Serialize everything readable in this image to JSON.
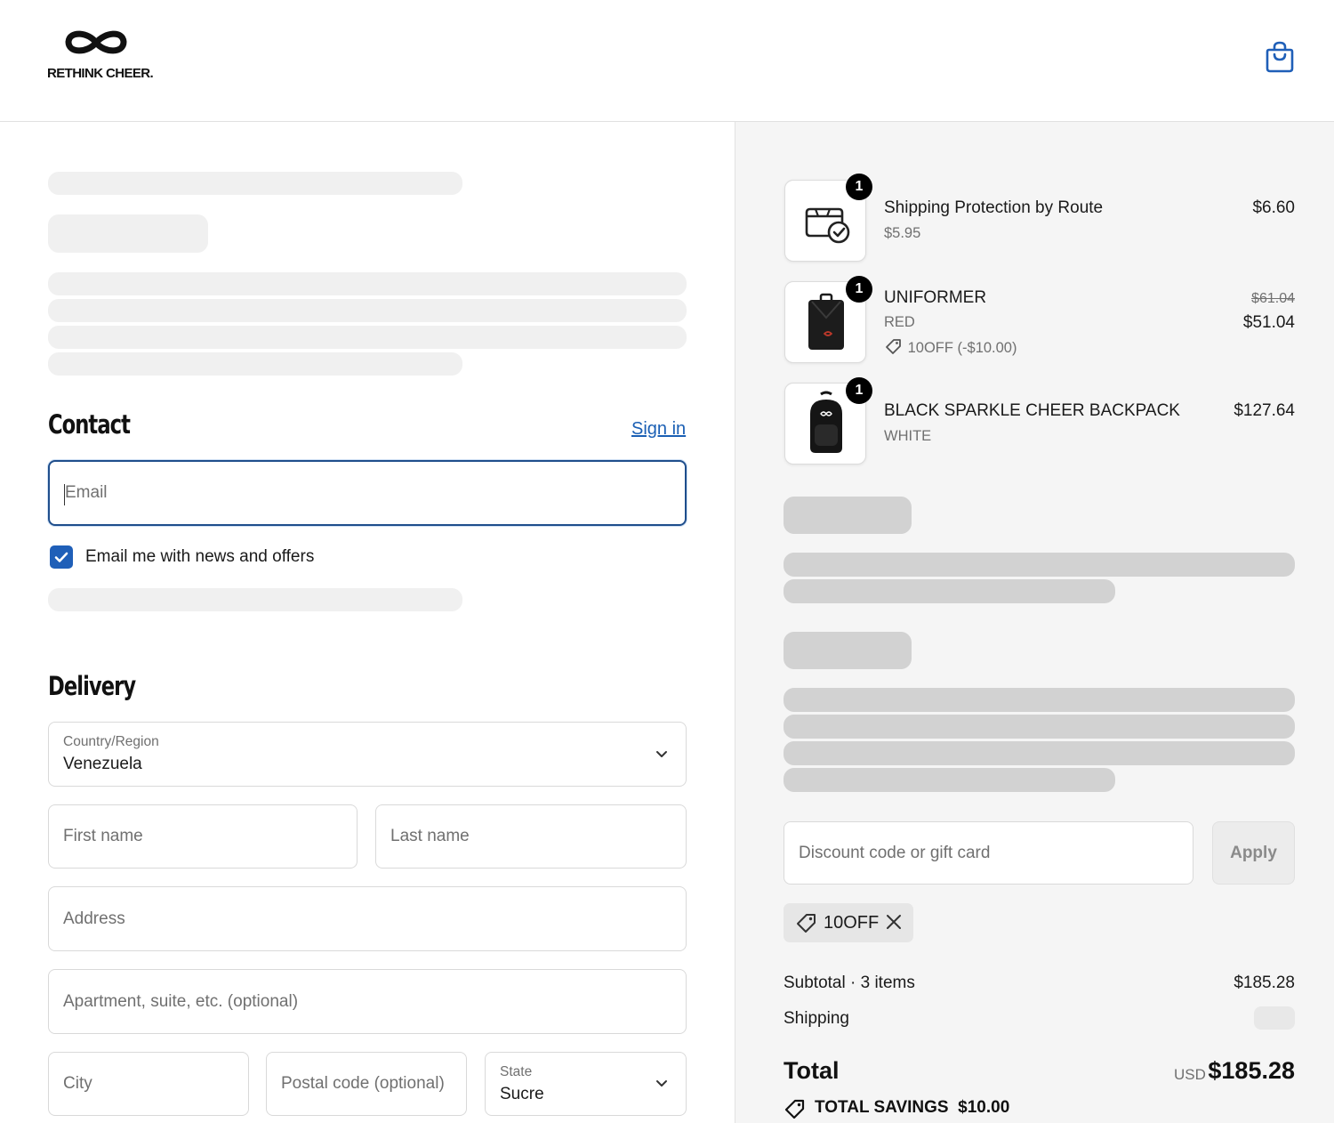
{
  "header": {
    "brand": "RETHINK CHEER."
  },
  "contact": {
    "title": "Contact",
    "sign_in": "Sign in",
    "email_placeholder": "Email",
    "news_label": "Email me with news and offers",
    "news_checked": true
  },
  "delivery": {
    "title": "Delivery",
    "country_label": "Country/Region",
    "country_value": "Venezuela",
    "first_name": "First name",
    "last_name": "Last name",
    "address": "Address",
    "apartment": "Apartment, suite, etc. (optional)",
    "city": "City",
    "postal": "Postal code (optional)",
    "state_label": "State",
    "state_value": "Sucre"
  },
  "cart": {
    "items": [
      {
        "qty": "1",
        "name": "Shipping Protection by Route",
        "sub": "$5.95",
        "price": "$6.60"
      },
      {
        "qty": "1",
        "name": "UNIFORMER",
        "variant": "RED",
        "discount": "10OFF (-$10.00)",
        "original_price": "$61.04",
        "price": "$51.04"
      },
      {
        "qty": "1",
        "name": "BLACK SPARKLE CHEER BACKPACK",
        "variant": "WHITE",
        "price": "$127.64"
      }
    ]
  },
  "discount": {
    "placeholder": "Discount code or gift card",
    "apply_label": "Apply",
    "applied_code": "10OFF"
  },
  "summary": {
    "subtotal_label": "Subtotal · 3 items",
    "subtotal_value": "$185.28",
    "shipping_label": "Shipping",
    "total_label": "Total",
    "currency": "USD",
    "total_value": "$185.28",
    "savings_label": "TOTAL SAVINGS",
    "savings_value": "$10.00"
  },
  "colors": {
    "accent": "#1f5fb8",
    "link": "#1a5fb4",
    "focus": "#1f4e8c",
    "sidebar_bg": "#f5f5f5"
  }
}
